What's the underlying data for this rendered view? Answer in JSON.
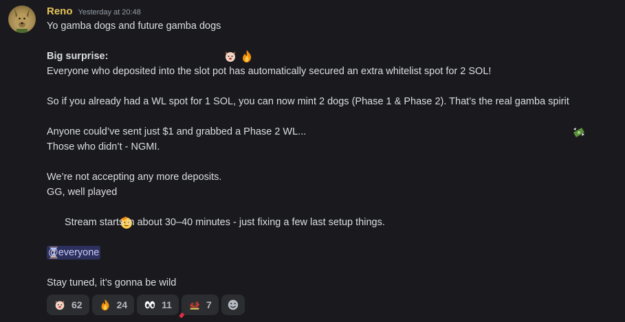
{
  "message": {
    "author": "Reno",
    "timestamp": "Yesterday at 20:48",
    "author_color": "#e8c65a",
    "avatar_icon": "dog-avatar-icon",
    "lines": {
      "l1": "Yo gamba dogs and future gamba dogs",
      "l2": "Big surprise:",
      "l3": "Everyone who deposited into the slot pot has automatically secured an extra whitelist spot for 2 SOL!",
      "l4": "So if you already had a WL spot for 1 SOL, you can now mint 2 dogs (Phase 1 & Phase 2). That’s the real gamba spirit",
      "l5": "Anyone could’ve sent just $1 and grabbed a Phase 2 WL...",
      "l6": "Those who didn’t - NGMI.",
      "l7": "We’re not accepting any more deposits.",
      "l8": "GG, well played",
      "l9": "Stream starts in about 30–40 minutes - just fixing a few last setup things.",
      "mention": "@everyone",
      "l10": "Stay tuned, it’s gonna be wild"
    }
  },
  "reactions": [
    {
      "icon": "dog-face-icon",
      "count": "62"
    },
    {
      "icon": "fire-icon",
      "count": "24"
    },
    {
      "icon": "eyes-icon",
      "count": "11"
    },
    {
      "icon": "custom-dog-emoji-icon",
      "count": "7"
    }
  ],
  "add_reaction_icon": "add-reaction-smiley-icon"
}
